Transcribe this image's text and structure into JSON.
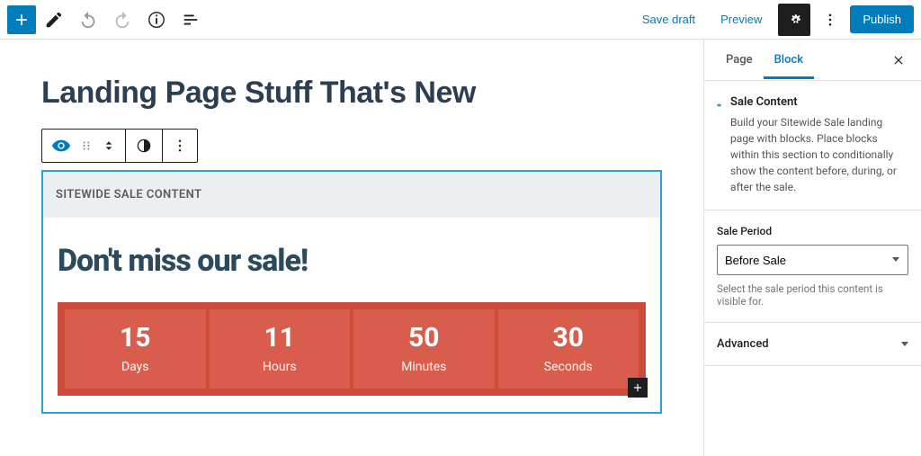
{
  "topbar": {
    "save_draft": "Save draft",
    "preview": "Preview",
    "publish": "Publish"
  },
  "page": {
    "title": "Landing Page Stuff That's New"
  },
  "block": {
    "header": "SITEWIDE SALE CONTENT",
    "heading": "Don't miss our sale!",
    "countdown": {
      "days_value": "15",
      "days_label": "Days",
      "hours_value": "11",
      "hours_label": "Hours",
      "minutes_value": "50",
      "minutes_label": "Minutes",
      "seconds_value": "30",
      "seconds_label": "Seconds"
    }
  },
  "sidebar": {
    "tab_page": "Page",
    "tab_block": "Block",
    "info_title": "Sale Content",
    "info_desc": "Build your Sitewide Sale landing page with blocks. Place blocks within this section to conditionally show the content before, during, or after the sale.",
    "period_label": "Sale Period",
    "period_value": "Before Sale",
    "period_help": "Select the sale period this content is visible for.",
    "advanced": "Advanced"
  }
}
